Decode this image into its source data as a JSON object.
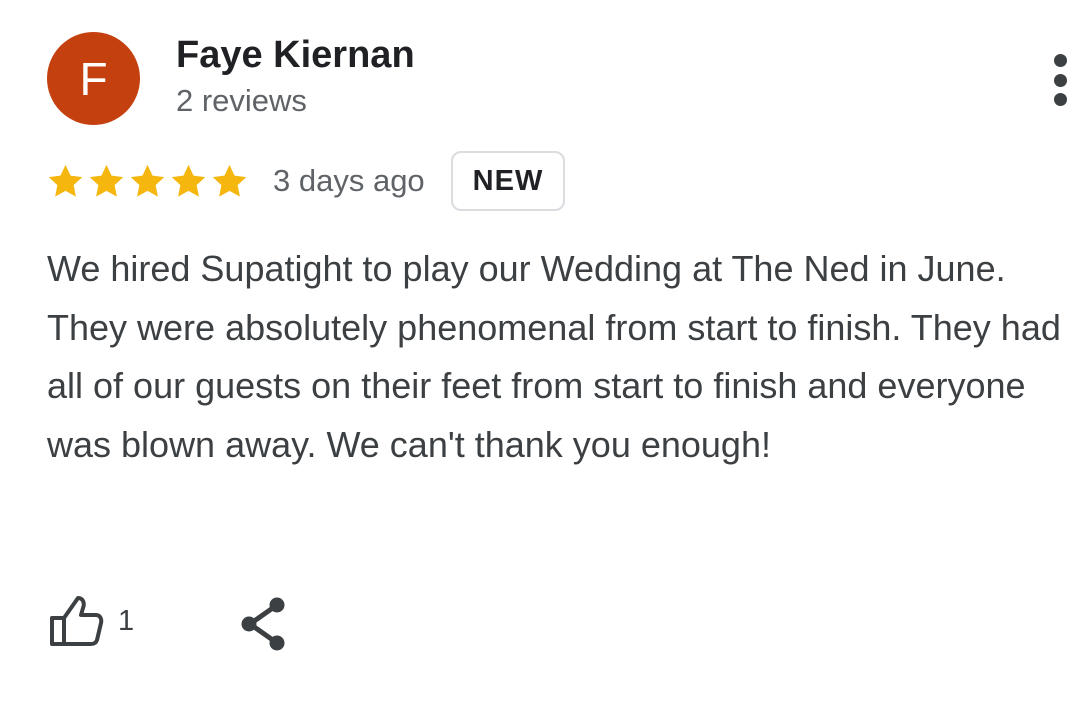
{
  "reviewer": {
    "avatar_letter": "F",
    "avatar_color": "#c5400f",
    "name": "Faye Kiernan",
    "review_count_text": "2 reviews"
  },
  "menu": {
    "icon": "more-vert-icon"
  },
  "review": {
    "rating": 5,
    "rating_max": 5,
    "star_color": "#f5b60d",
    "date": "3 days ago",
    "badge": "NEW",
    "text": "We hired Supatight to play our Wedding at The Ned in June. They were absolutely phenomenal from start to finish. They had all of our guests on their feet from start to finish and everyone was blown away. We can't thank you enough!"
  },
  "actions": {
    "like_icon": "thumbs-up-icon",
    "like_count": "1",
    "share_icon": "share-icon"
  }
}
